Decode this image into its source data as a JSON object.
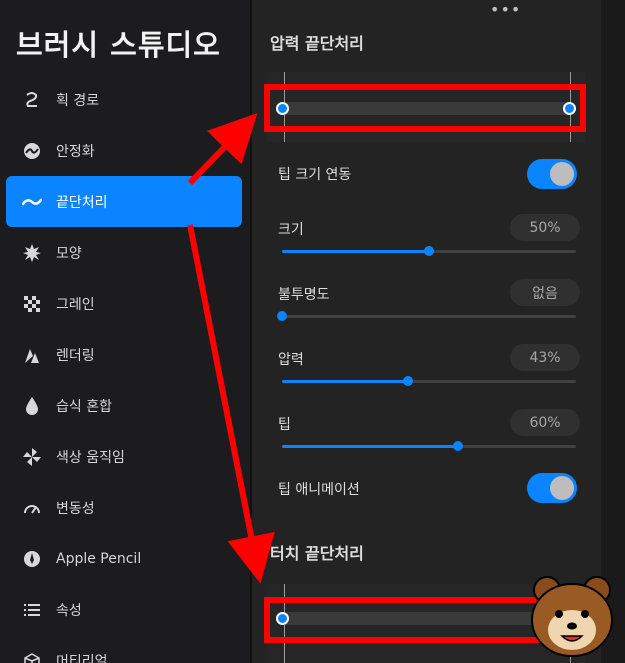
{
  "sidebar": {
    "title": "브러시 스튜디오",
    "items": [
      {
        "label": "획 경로",
        "icon": "stroke-path-icon",
        "glyph": "Ƨ",
        "active": false
      },
      {
        "label": "안정화",
        "icon": "stabilization-icon",
        "glyph": "◒",
        "active": false
      },
      {
        "label": "끝단처리",
        "icon": "taper-icon",
        "glyph": "〜",
        "active": true
      },
      {
        "label": "모양",
        "icon": "shape-icon",
        "glyph": "✸",
        "active": false
      },
      {
        "label": "그레인",
        "icon": "grain-icon",
        "glyph": "▩",
        "active": false
      },
      {
        "label": "렌더링",
        "icon": "rendering-icon",
        "glyph": "◭",
        "active": false
      },
      {
        "label": "습식 혼합",
        "icon": "wet-mix-icon",
        "glyph": "💧",
        "active": false
      },
      {
        "label": "색상 움직임",
        "icon": "color-dynamics-icon",
        "glyph": "✲",
        "active": false
      },
      {
        "label": "변동성",
        "icon": "dynamics-icon",
        "glyph": "◜",
        "active": false
      },
      {
        "label": "Apple Pencil",
        "icon": "apple-pencil-icon",
        "glyph": "✎",
        "active": false
      },
      {
        "label": "속성",
        "icon": "properties-icon",
        "glyph": "☰",
        "active": false
      },
      {
        "label": "머티리얼",
        "icon": "materials-icon",
        "glyph": "⬡",
        "active": false
      }
    ]
  },
  "main": {
    "more_dots": "•••",
    "pressure_taper": {
      "title": "압력 끝단처리",
      "start": 0.0,
      "end": 1.0
    },
    "tip_size_link": {
      "label": "팁 크기 연동",
      "on": true
    },
    "size": {
      "label": "크기",
      "value_text": "50%",
      "value": 0.5
    },
    "opacity": {
      "label": "불투명도",
      "value_text": "없음",
      "value": 0.0
    },
    "pressure": {
      "label": "압력",
      "value_text": "43%",
      "value": 0.43
    },
    "tip": {
      "label": "팁",
      "value_text": "60%",
      "value": 0.6
    },
    "tip_animation": {
      "label": "팁 애니메이션",
      "on": true
    },
    "touch_taper": {
      "title": "터치 끝단처리",
      "start": 0.0,
      "end": 1.0
    }
  },
  "colors": {
    "accent": "#0a84ff",
    "annotation": "#ff0000",
    "sidebar_bg": "#1c1c1e",
    "panel_bg": "#232323"
  }
}
